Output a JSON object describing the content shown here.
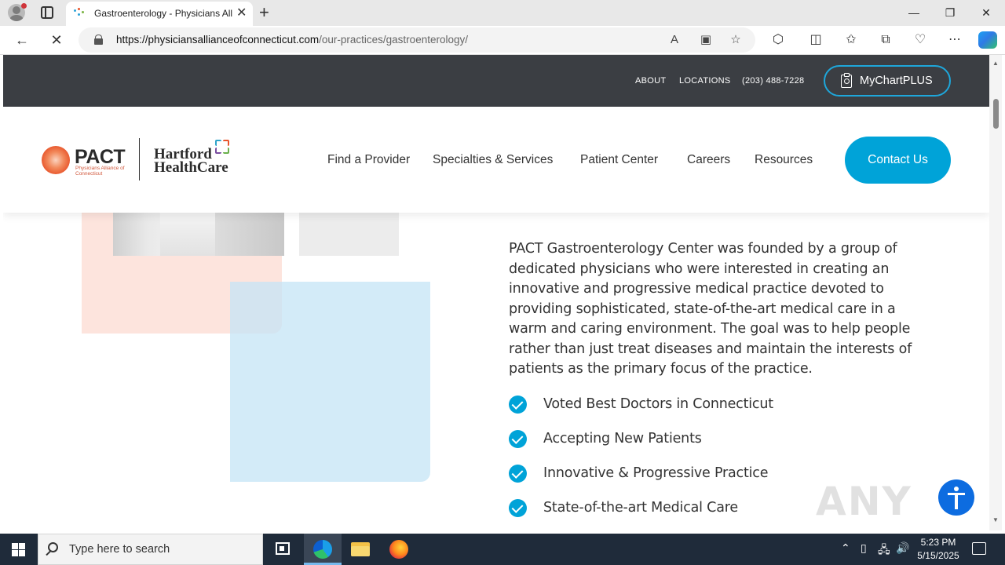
{
  "browser": {
    "tab_title": "Gastroenterology - Physicians Alli",
    "url_host": "https://physiciansallianceofconnecticut.com",
    "url_path": "/our-practices/gastroenterology/",
    "window_buttons": {
      "minimize": "—",
      "restore": "❐",
      "close": "✕"
    },
    "new_tab": "+",
    "tab_close": "✕"
  },
  "page": {
    "utility_nav": {
      "about": "ABOUT",
      "locations": "LOCATIONS",
      "phone": "(203) 488-7228",
      "mychart": "MyChartPLUS"
    },
    "logo": {
      "pact": "PACT",
      "pact_sub": "Physicians Alliance of Connecticut",
      "hhc_line1": "Hartford",
      "hhc_line2": "HealthCare"
    },
    "main_nav": [
      {
        "label": "Find a Provider"
      },
      {
        "label": "Specialties & Services"
      },
      {
        "label": "Patient Center"
      },
      {
        "label": "Careers"
      },
      {
        "label": "Resources"
      }
    ],
    "contact_button": "Contact Us",
    "intro": "PACT Gastroenterology Center was founded by a group of dedicated physicians who were interested in creating an innovative and progressive medical practice devoted to providing sophisticated, state-of-the-art medical care in a warm and caring environment. The goal was to help people rather than just treat diseases and maintain the interests of patients as the primary focus of the practice.",
    "features": [
      {
        "label": "Voted Best Doctors in Connecticut"
      },
      {
        "label": "Accepting New Patients"
      },
      {
        "label": "Innovative & Progressive Practice"
      },
      {
        "label": "State-of-the-art Medical Care"
      }
    ],
    "watermark": "ANY RUN",
    "colors": {
      "accent": "#00a3d8",
      "dark_strip": "#3b3e43",
      "pink_block": "#fde4dd",
      "blue_block": "#c4e4f5"
    }
  },
  "taskbar": {
    "search_placeholder": "Type here to search",
    "time": "5:23 PM",
    "date": "5/15/2025"
  }
}
